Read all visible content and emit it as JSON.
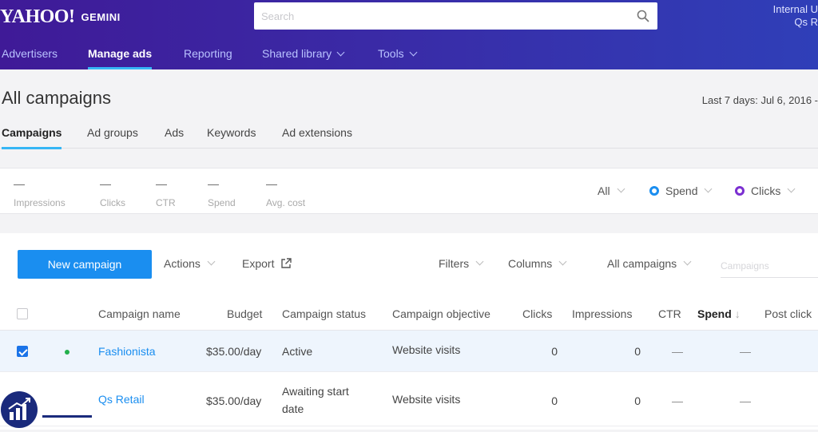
{
  "brand": {
    "yahoo": "YAHOO!",
    "gemini": "GEMINI"
  },
  "search": {
    "placeholder": "Search"
  },
  "user": {
    "line1": "Internal U",
    "line2": "Qs R"
  },
  "nav": [
    {
      "label": "Advertisers"
    },
    {
      "label": "Manage ads",
      "active": true
    },
    {
      "label": "Reporting"
    },
    {
      "label": "Shared library"
    },
    {
      "label": "Tools"
    }
  ],
  "page": {
    "title": "All campaigns",
    "daterange": "Last 7 days: Jul 6, 2016 -"
  },
  "tabs": [
    "Campaigns",
    "Ad groups",
    "Ads",
    "Keywords",
    "Ad extensions"
  ],
  "metrics": [
    {
      "value": "—",
      "label": "Impressions"
    },
    {
      "value": "—",
      "label": "Clicks"
    },
    {
      "value": "—",
      "label": "CTR"
    },
    {
      "value": "—",
      "label": "Spend"
    },
    {
      "value": "—",
      "label": "Avg. cost"
    }
  ],
  "metric_controls": {
    "all": "All",
    "series1": "Spend",
    "series2": "Clicks",
    "series1_color": "#1a8ef0",
    "series2_color": "#7b2fd1"
  },
  "toolbar": {
    "new_campaign": "New campaign",
    "actions": "Actions",
    "export": "Export",
    "filters": "Filters",
    "columns": "Columns",
    "all_campaigns": "All campaigns",
    "campaign_search_placeholder": "Campaigns"
  },
  "table": {
    "headers": {
      "name": "Campaign name",
      "budget": "Budget",
      "status": "Campaign status",
      "objective": "Campaign objective",
      "clicks": "Clicks",
      "impressions": "Impressions",
      "ctr": "CTR",
      "spend": "Spend",
      "post_click": "Post click"
    },
    "rows": [
      {
        "name": "Fashionista",
        "budget": "$35.00/day",
        "status": "Active",
        "objective": "Website visits",
        "clicks": "0",
        "impressions": "0",
        "ctr": "—",
        "spend": "—"
      },
      {
        "name": "Qs Retail",
        "budget": "$35.00/day",
        "status_line1": "Awaiting start",
        "status_line2": "date",
        "objective": "Website visits",
        "clicks": "0",
        "impressions": "0",
        "ctr": "—",
        "spend": "—"
      }
    ]
  }
}
